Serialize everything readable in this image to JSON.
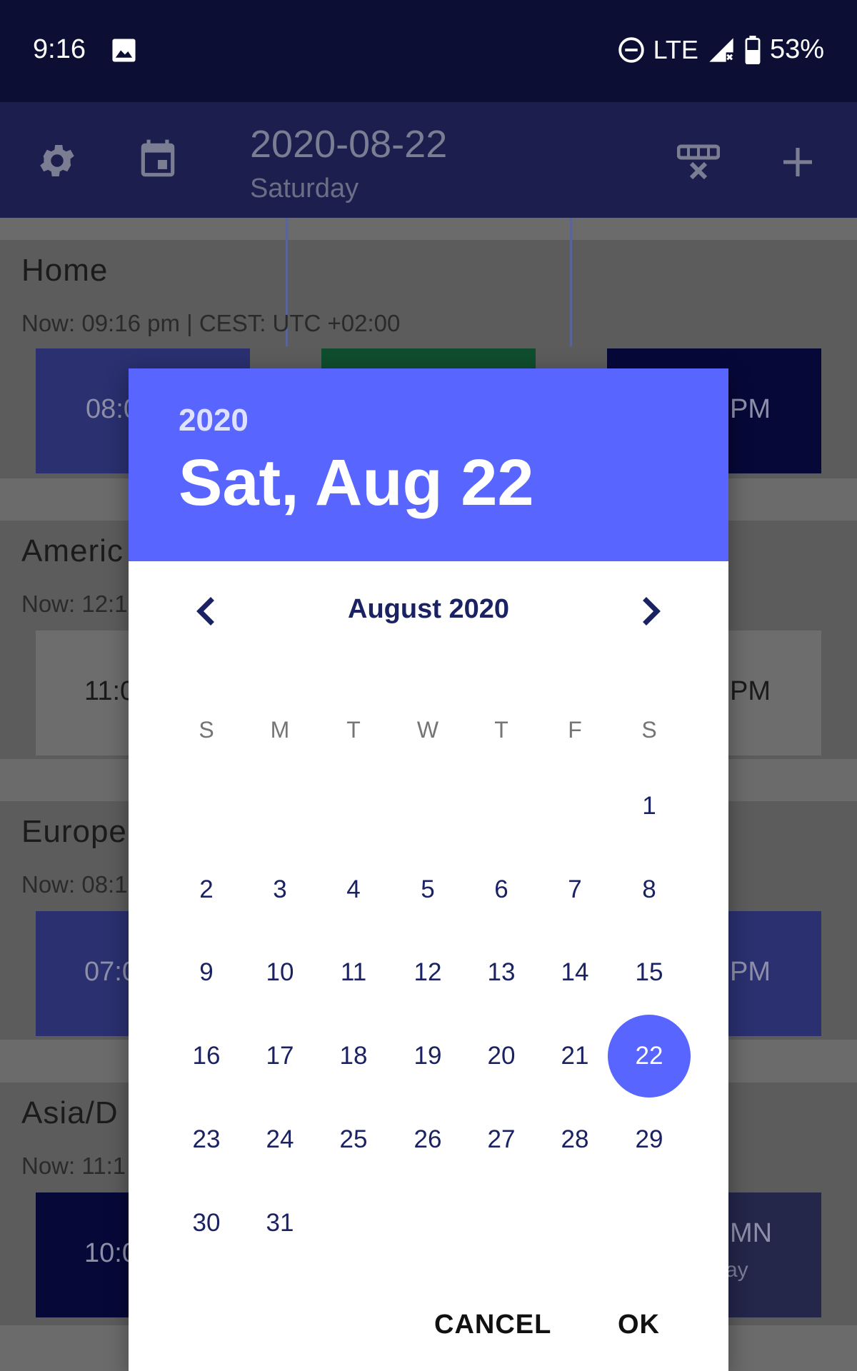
{
  "status_bar": {
    "time": "9:16",
    "network": "LTE",
    "battery": "53%"
  },
  "app_bar": {
    "date": "2020-08-22",
    "weekday": "Saturday",
    "icons": [
      "gear-icon",
      "calendar-icon",
      "grid-remove-icon",
      "plus-icon"
    ]
  },
  "background": {
    "zones": [
      {
        "title": "Home",
        "now": "Now: 09:16 pm | CEST: UTC +02:00",
        "tiles": [
          "08:0",
          "",
          "PM"
        ]
      },
      {
        "title": "Americ",
        "now": "Now: 12:1",
        "tiles": [
          "11:0",
          "PM"
        ]
      },
      {
        "title": "Europe",
        "now": "Now: 08:1",
        "tiles": [
          "07:0",
          "PM"
        ]
      },
      {
        "title": "Asia/D",
        "now": "Now: 11:1",
        "tiles": [
          "10:0",
          "MN",
          "ay"
        ]
      }
    ]
  },
  "dialog": {
    "header_year": "2020",
    "header_date": "Sat, Aug 22",
    "month_label": "August 2020",
    "weekdays": [
      "S",
      "M",
      "T",
      "W",
      "T",
      "F",
      "S"
    ],
    "days": [
      "1",
      "2",
      "3",
      "4",
      "5",
      "6",
      "7",
      "8",
      "9",
      "10",
      "11",
      "12",
      "13",
      "14",
      "15",
      "16",
      "17",
      "18",
      "19",
      "20",
      "21",
      "22",
      "23",
      "24",
      "25",
      "26",
      "27",
      "28",
      "29",
      "30",
      "31"
    ],
    "selected_day": "22",
    "cancel_label": "CANCEL",
    "ok_label": "OK",
    "colors": {
      "accent": "#5865ff",
      "day_text": "#1b2264"
    }
  }
}
